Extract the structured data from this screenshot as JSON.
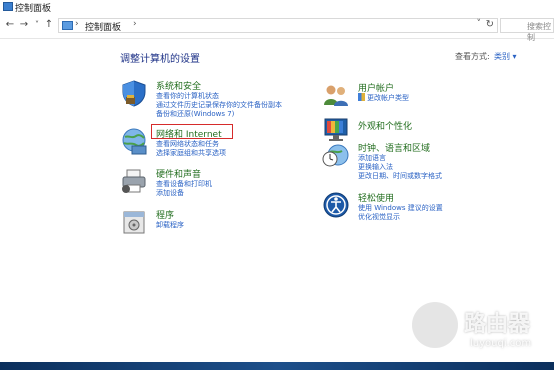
{
  "window": {
    "title": "控制面板"
  },
  "nav": {
    "back": "←",
    "forward": "→",
    "dropdown": "˅",
    "up": "↑",
    "address_sep": "›",
    "breadcrumb": "控制面板",
    "crumb_chevron": "›",
    "address_dropdown": "˅",
    "refresh": "↻",
    "search_placeholder": "搜索控制"
  },
  "main": {
    "heading": "调整计算机的设置",
    "view_by_label": "查看方式:",
    "view_by_value": "类别 ▾"
  },
  "categories_left": [
    {
      "title": "系统和安全",
      "links": [
        "查看你的计算机状态",
        "通过文件历史记录保存你的文件备份副本",
        "备份和还原(Windows 7)"
      ],
      "icon": "shield-icon"
    },
    {
      "title": "网络和 Internet",
      "links": [
        "查看网络状态和任务",
        "选择家庭组和共享选项"
      ],
      "icon": "network-icon"
    },
    {
      "title": "硬件和声音",
      "links": [
        "查看设备和打印机",
        "添加设备"
      ],
      "icon": "printer-icon"
    },
    {
      "title": "程序",
      "links": [
        "卸载程序"
      ],
      "icon": "programs-icon"
    }
  ],
  "categories_right": [
    {
      "title": "用户帐户",
      "links": [
        "更改帐户类型"
      ],
      "icon": "users-icon"
    },
    {
      "title": "外观和个性化",
      "links": [],
      "icon": "appearance-icon"
    },
    {
      "title": "时钟、语言和区域",
      "links": [
        "添加语言",
        "更换输入法",
        "更改日期、时间或数字格式"
      ],
      "icon": "clock-globe-icon"
    },
    {
      "title": "轻松使用",
      "links": [
        "使用 Windows 建议的设置",
        "优化视觉显示"
      ],
      "icon": "ease-of-access-icon"
    }
  ],
  "watermark": {
    "text": "路由器",
    "url": "luyouqi.com"
  },
  "colors": {
    "category_title": "#236e1f",
    "link": "#2a62c4",
    "heading": "#1e3287",
    "highlight": "#d62b2b"
  }
}
